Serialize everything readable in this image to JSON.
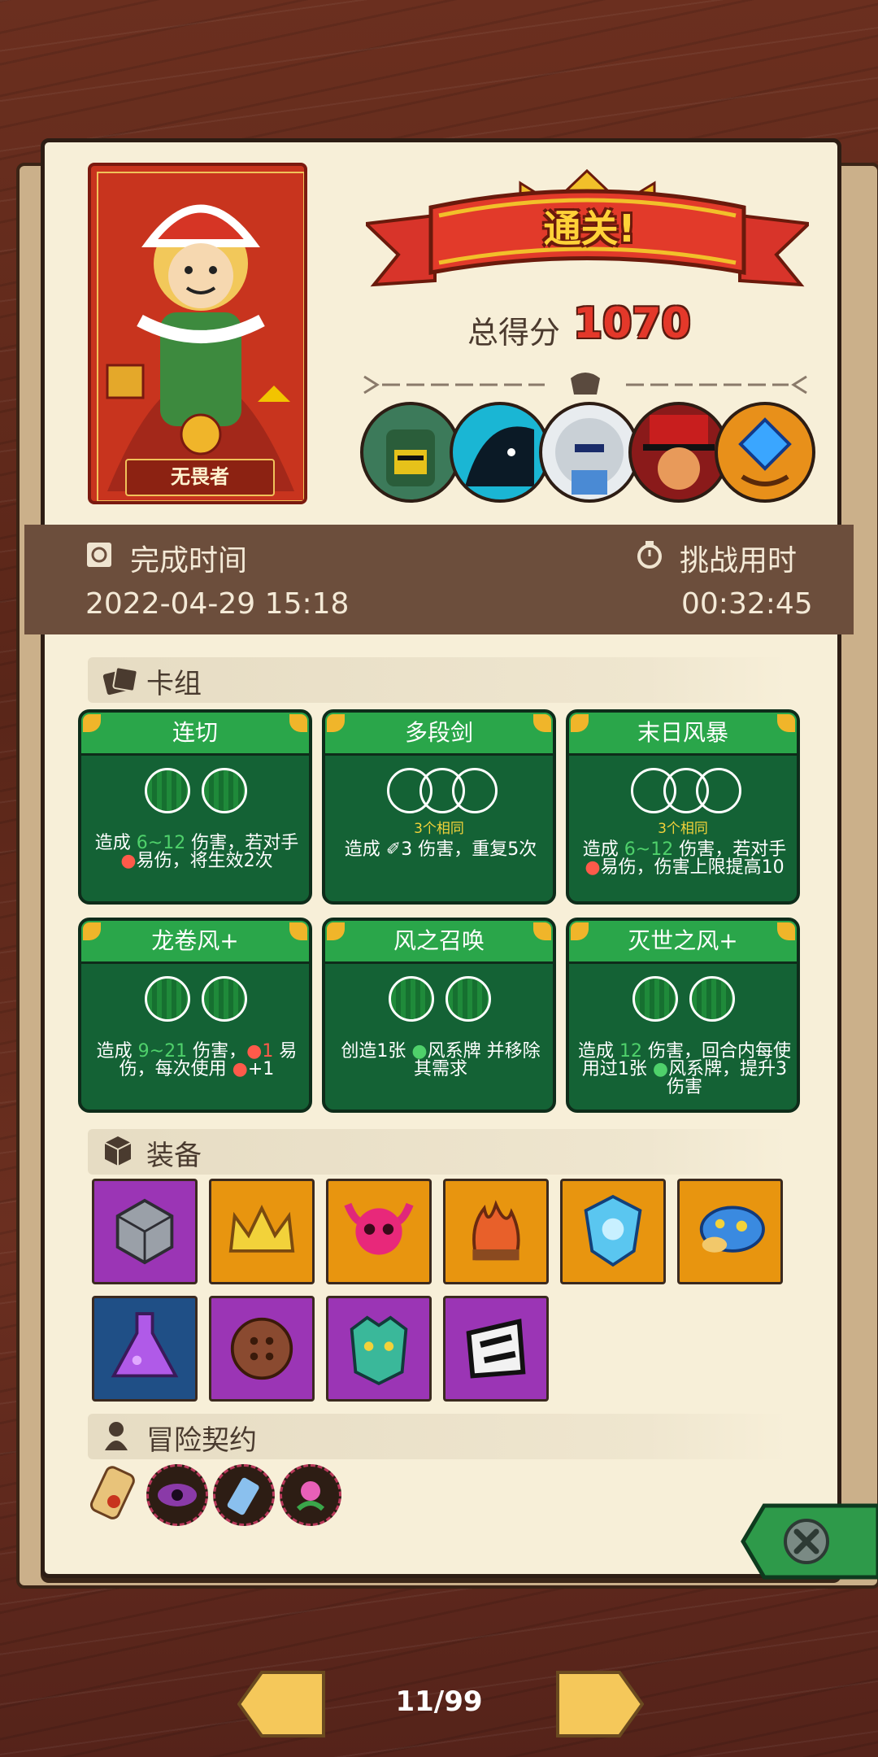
{
  "hero": {
    "name": "无畏者"
  },
  "banner": {
    "title": "通关!"
  },
  "score": {
    "label": "总得分",
    "value": "1070"
  },
  "bosses": [
    "green-helmet-boss",
    "shadow-beast-boss",
    "white-hair-boss",
    "red-top-hat-boss",
    "blue-crystal-boss"
  ],
  "info": {
    "finish_label": "完成时间",
    "finish_value": "2022-04-29 15:18",
    "duration_label": "挑战用时",
    "duration_value": "00:32:45"
  },
  "sections": {
    "deck": "卡组",
    "equipment": "装备",
    "contract": "冒险契约"
  },
  "cards": [
    {
      "title": "连切",
      "orbs": 2,
      "same": "",
      "desc": [
        "造成 ",
        {
          "g": "6~12"
        },
        " 伤害，若对手 ",
        {
          "r": "●"
        },
        "易伤，将生效2次"
      ]
    },
    {
      "title": "多段剑",
      "orbs": 3,
      "same": "3个相同",
      "desc": [
        "造成 ",
        {
          "w": "✐"
        },
        "3 伤害，重复5次"
      ]
    },
    {
      "title": "末日风暴",
      "orbs": 3,
      "same": "3个相同",
      "desc": [
        "造成 ",
        {
          "g": "6~12"
        },
        " 伤害，若对手 ",
        {
          "r": "●"
        },
        "易伤，伤害上限提高10"
      ]
    },
    {
      "title": "龙卷风+",
      "orbs": 2,
      "same": "",
      "desc": [
        "造成 ",
        {
          "g": "9~21"
        },
        " 伤害，",
        {
          "r": "●"
        },
        {
          "r": "1"
        },
        " 易伤，每次使用 ",
        {
          "r": "●"
        },
        "+1"
      ]
    },
    {
      "title": "风之召唤",
      "orbs": 2,
      "same": "",
      "desc": [
        "创造1张 ",
        {
          "g": "●"
        },
        "风系牌 并移除其需求"
      ]
    },
    {
      "title": "灭世之风+",
      "orbs": 2,
      "same": "",
      "desc": [
        "造成 ",
        {
          "g": "12"
        },
        " 伤害，回合内每使用过1张 ",
        {
          "g": "●"
        },
        "风系牌，提升3伤害"
      ]
    }
  ],
  "equipment": [
    {
      "icon": "stone-cube-icon",
      "color": "#9b35b5"
    },
    {
      "icon": "crown-icon",
      "color": "#e8950f"
    },
    {
      "icon": "horned-skull-icon",
      "color": "#e8950f"
    },
    {
      "icon": "flame-wood-icon",
      "color": "#e8950f"
    },
    {
      "icon": "ice-shield-icon",
      "color": "#e8950f"
    },
    {
      "icon": "blue-spotted-mushroom-icon",
      "color": "#e8950f"
    },
    {
      "icon": "purple-potion-flask-icon",
      "color": "#1f4f86"
    },
    {
      "icon": "wooden-button-icon",
      "color": "#9b35b5"
    },
    {
      "icon": "green-demon-mask-icon",
      "color": "#9b35b5"
    },
    {
      "icon": "broken-rune-icon",
      "color": "#9b35b5"
    }
  ],
  "contracts": [
    "scroll-icon",
    "purple-eye-icon",
    "blue-tag-icon",
    "pink-flower-icon"
  ],
  "pager": {
    "current": "11/99"
  }
}
